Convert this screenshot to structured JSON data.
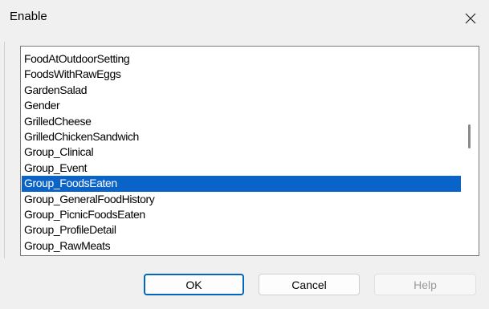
{
  "dialog": {
    "title": "Enable",
    "close_icon": "close-icon"
  },
  "list": {
    "items": [
      "FoodAtOutdoorSetting",
      "FoodsWithRawEggs",
      "GardenSalad",
      "Gender",
      "GrilledCheese",
      "GrilledChickenSandwich",
      "Group_Clinical",
      "Group_Event",
      "Group_FoodsEaten",
      "Group_GeneralFoodHistory",
      "Group_PicnicFoodsEaten",
      "Group_ProfileDetail",
      "Group_RawMeats"
    ],
    "selected_index": 8,
    "selected_color": "#0a63c9"
  },
  "buttons": {
    "ok": "OK",
    "cancel": "Cancel",
    "help": "Help"
  }
}
